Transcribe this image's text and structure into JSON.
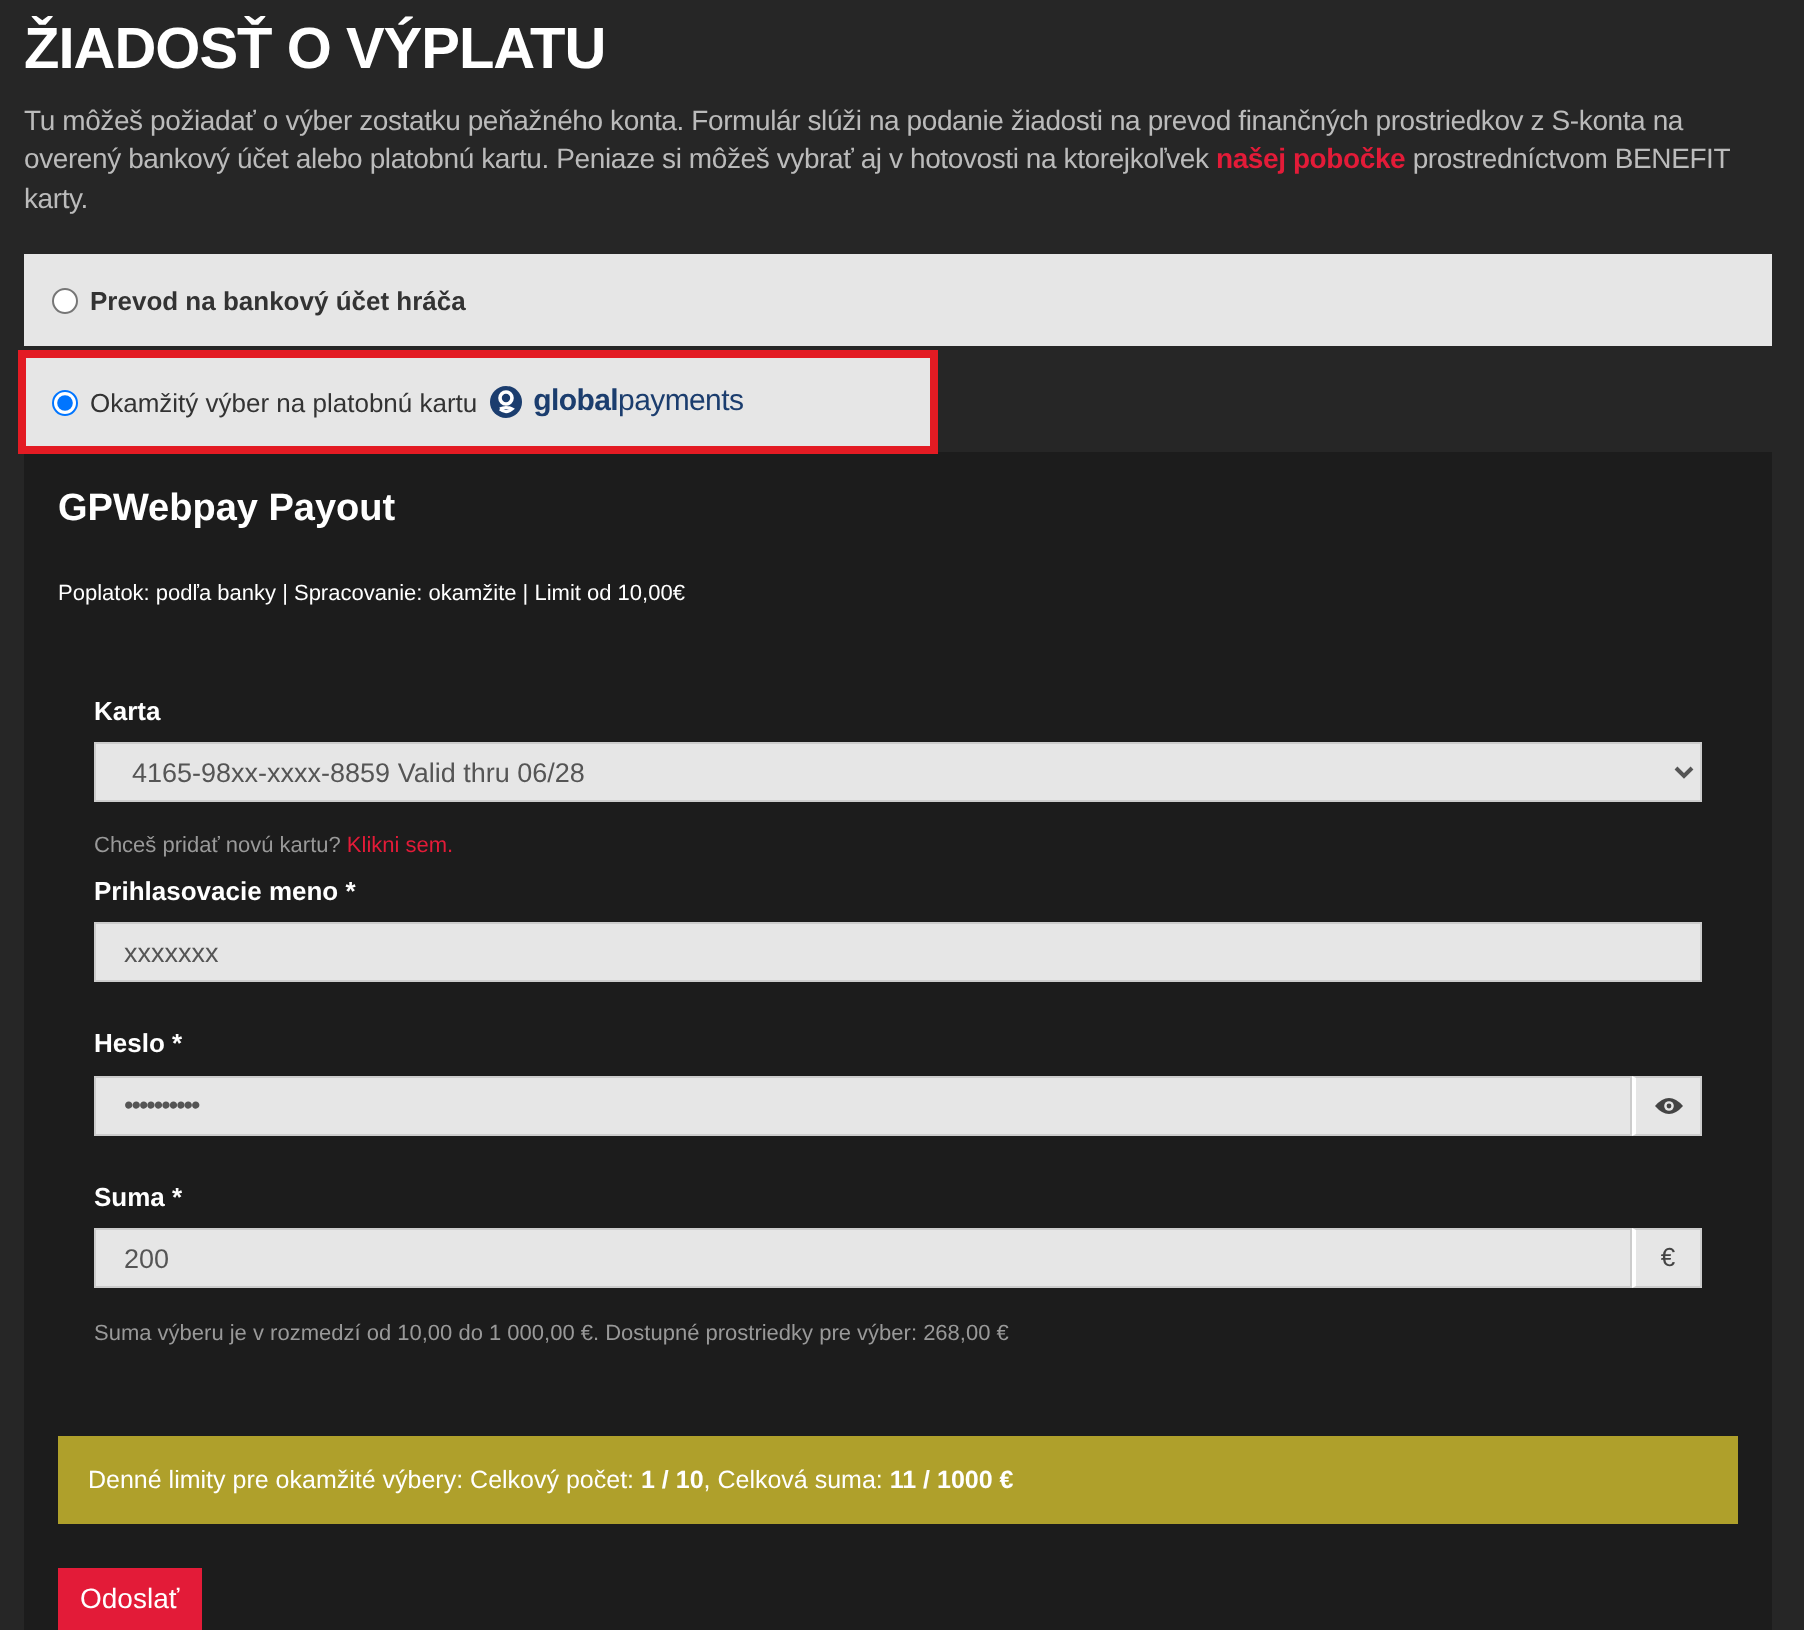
{
  "title": "ŽIADOSŤ O VÝPLATU",
  "intro": {
    "text": "Tu môžeš požiadať o výber zostatku peňažného konta. Formulár slúži na podanie žiadosti na prevod finančných prostriedkov z S-konta na overený bankový účet alebo platobnú kartu. Peniaze si môžeš vybrať aj v hotovosti na ktorejkoľvek",
    "link": "našej pobočke",
    "after": "prostredníctvom BENEFIT karty."
  },
  "methods": [
    {
      "label": "Prevod na bankový účet hráča",
      "selected": false,
      "highlighted": false
    },
    {
      "label": "Okamžitý výber na platobnú kartu",
      "selected": true,
      "highlighted": true,
      "logo": "**global**payments"
    }
  ],
  "panel": {
    "title": "GPWebpay Payout",
    "info": "Poplatok: podľa banky | Spracovanie: okamžite | Limit od 10,00€",
    "card": {
      "label": "Karta",
      "value": "4165-98xx-xxxx-8859 Valid thru 06/28",
      "hint": "Chceš pridať novú kartu?",
      "hint_link": "Klikni sem."
    },
    "fields": [
      {
        "kind": "text",
        "label": "Prihlasovacie meno *",
        "value": "xxxxxxx"
      },
      {
        "kind": "password",
        "label": "Heslo *",
        "value": "••••••••••"
      },
      {
        "kind": "amount",
        "label": "Suma *",
        "value": "200",
        "addon": "€"
      }
    ],
    "amount_hint": "Suma výberu je v rozmedzí od 10,00 do 1 000,00 €. Dostupné prostriedky pre výber: 268,00 €",
    "limits": "Denné limity pre okamžité výbery: Celkový počet: **1 / 10**, Celková suma: **11 / 1000 €**",
    "submit": "Odoslať"
  }
}
